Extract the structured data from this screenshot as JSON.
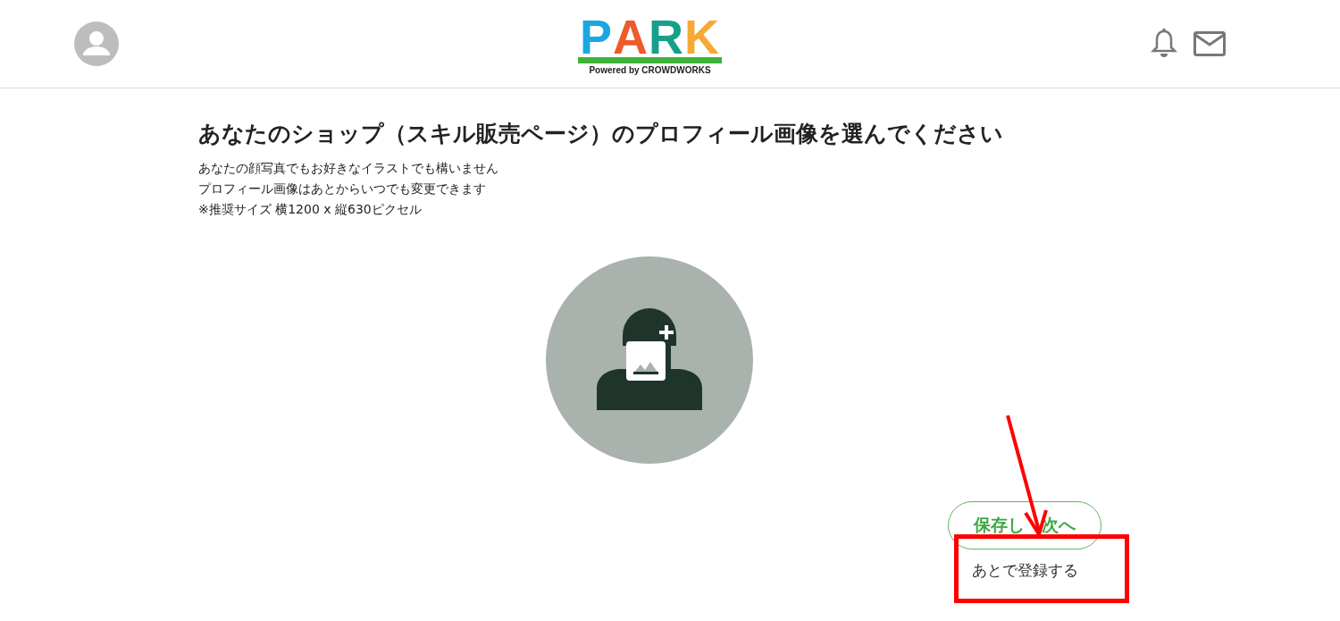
{
  "header": {
    "logo": {
      "letters": [
        {
          "text": "P",
          "color": "#1ba6e2"
        },
        {
          "text": "A",
          "color": "#ee5a2a"
        },
        {
          "text": "R",
          "color": "#16a08a"
        },
        {
          "text": "K",
          "color": "#f6a933"
        }
      ],
      "tagline": "Powered by CROWDWORKS"
    }
  },
  "page": {
    "title": "あなたのショップ（スキル販売ページ）のプロフィール画像を選んでください",
    "notes": [
      "あなたの顔写真でもお好きなイラストでも構いません",
      "プロフィール画像はあとからいつでも変更できます",
      "※推奨サイズ 横1200 x 縦630ピクセル"
    ]
  },
  "actions": {
    "primary": [
      "保存し",
      "次へ"
    ],
    "secondary": "あとで登録する"
  }
}
